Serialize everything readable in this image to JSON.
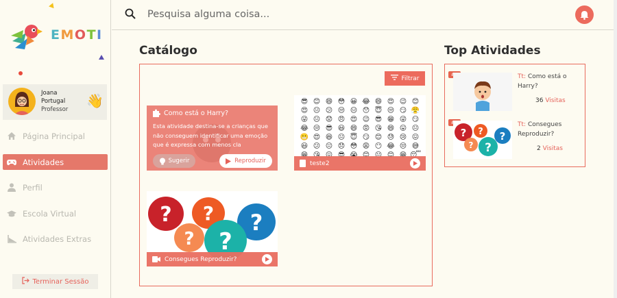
{
  "app": {
    "logo_text": [
      "E",
      "M",
      "O",
      "T",
      "I"
    ],
    "logo_colors": [
      "#4cb3c1",
      "#f09a3e",
      "#e25a5a",
      "#7ec23d",
      "#5a8bd8"
    ]
  },
  "colors": {
    "accent": "#ec6b5d",
    "background": "#fdfbf1"
  },
  "user": {
    "name": "Joana Portugal",
    "role": "Professor"
  },
  "sidebar": {
    "items": [
      {
        "label": "Página Principal",
        "icon": "home-icon",
        "active": false
      },
      {
        "label": "Atividades",
        "icon": "gamepad-icon",
        "active": true
      },
      {
        "label": "Perfil",
        "icon": "person-icon",
        "active": false
      },
      {
        "label": "Escola Virtual",
        "icon": "graduation-cap-icon",
        "active": false
      },
      {
        "label": "Atividades Extras",
        "icon": "chart-icon",
        "active": false
      }
    ],
    "logout_label": "Terminar Sessão"
  },
  "search": {
    "placeholder": "Pesquisa alguma coisa..."
  },
  "catalog": {
    "title": "Catálogo",
    "filter_label": "Filtrar",
    "cards": [
      {
        "title": "Como está o Harry?",
        "description": "Esta atividade destina-se a crianças que não conseguem identificar uma emoção que é expressa com menos cla",
        "suggest_label": "Sugerir",
        "play_label": "Reproduzir"
      },
      {
        "title": "teste2"
      },
      {
        "title": "Consegues Reproduzir?"
      }
    ]
  },
  "top": {
    "title": "Top Atividades",
    "items": [
      {
        "rank": "#1",
        "prefix": "Tt:",
        "title": "Como está o Harry?",
        "visits": "36",
        "visits_label": "Visitas"
      },
      {
        "rank": "#2",
        "prefix": "Tt:",
        "title": "Consegues Reproduzir?",
        "visits": "2",
        "visits_label": "Visitas"
      }
    ]
  }
}
